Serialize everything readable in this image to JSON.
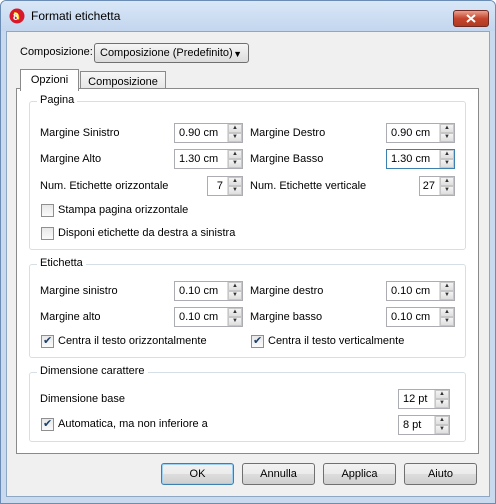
{
  "window": {
    "title": "Formati etichetta"
  },
  "composizione": {
    "label": "Composizione:",
    "value": "Composizione (Predefinito)"
  },
  "tabs": [
    {
      "label": "Opzioni"
    },
    {
      "label": "Composizione"
    }
  ],
  "pagina": {
    "title": "Pagina",
    "margine_sinistro": {
      "label": "Margine Sinistro",
      "value": "0.90 cm"
    },
    "margine_destro": {
      "label": "Margine Destro",
      "value": "0.90 cm"
    },
    "margine_alto": {
      "label": "Margine Alto",
      "value": "1.30 cm"
    },
    "margine_basso": {
      "label": "Margine Basso",
      "value": "1.30 cm"
    },
    "num_orizzontale": {
      "label": "Num. Etichette orizzontale",
      "value": "7"
    },
    "num_verticale": {
      "label": "Num. Etichette verticale",
      "value": "27"
    },
    "stampa_orizzontale": {
      "label": "Stampa pagina orizzontale",
      "checked": false
    },
    "disponi_destra": {
      "label": "Disponi etichette da destra a sinistra",
      "checked": false
    }
  },
  "etichetta": {
    "title": "Etichetta",
    "margine_sinistro": {
      "label": "Margine sinistro",
      "value": "0.10 cm"
    },
    "margine_destro": {
      "label": "Margine destro",
      "value": "0.10 cm"
    },
    "margine_alto": {
      "label": "Margine alto",
      "value": "0.10 cm"
    },
    "margine_basso": {
      "label": "Margine basso",
      "value": "0.10 cm"
    },
    "centra_orizz": {
      "label": "Centra il testo orizzontalmente",
      "checked": true
    },
    "centra_vert": {
      "label": "Centra il testo verticalmente",
      "checked": true
    }
  },
  "dimensione": {
    "title": "Dimensione carattere",
    "base": {
      "label": "Dimensione base",
      "value": "12 pt"
    },
    "automatica": {
      "label": "Automatica, ma non inferiore a",
      "checked": true,
      "value": "8 pt"
    }
  },
  "buttons": {
    "ok": "OK",
    "annulla": "Annulla",
    "applica": "Applica",
    "aiuto": "Aiuto"
  },
  "icons": {
    "app": "banana-app-icon",
    "close": "close-icon",
    "spin_up": "arrow-up-icon",
    "spin_down": "arrow-down-icon",
    "dropdown": "chevron-down-icon"
  },
  "colors": {
    "close_button": "#c5452d",
    "titlebar": "#c9daee",
    "focus_border": "#3c7fb1"
  }
}
